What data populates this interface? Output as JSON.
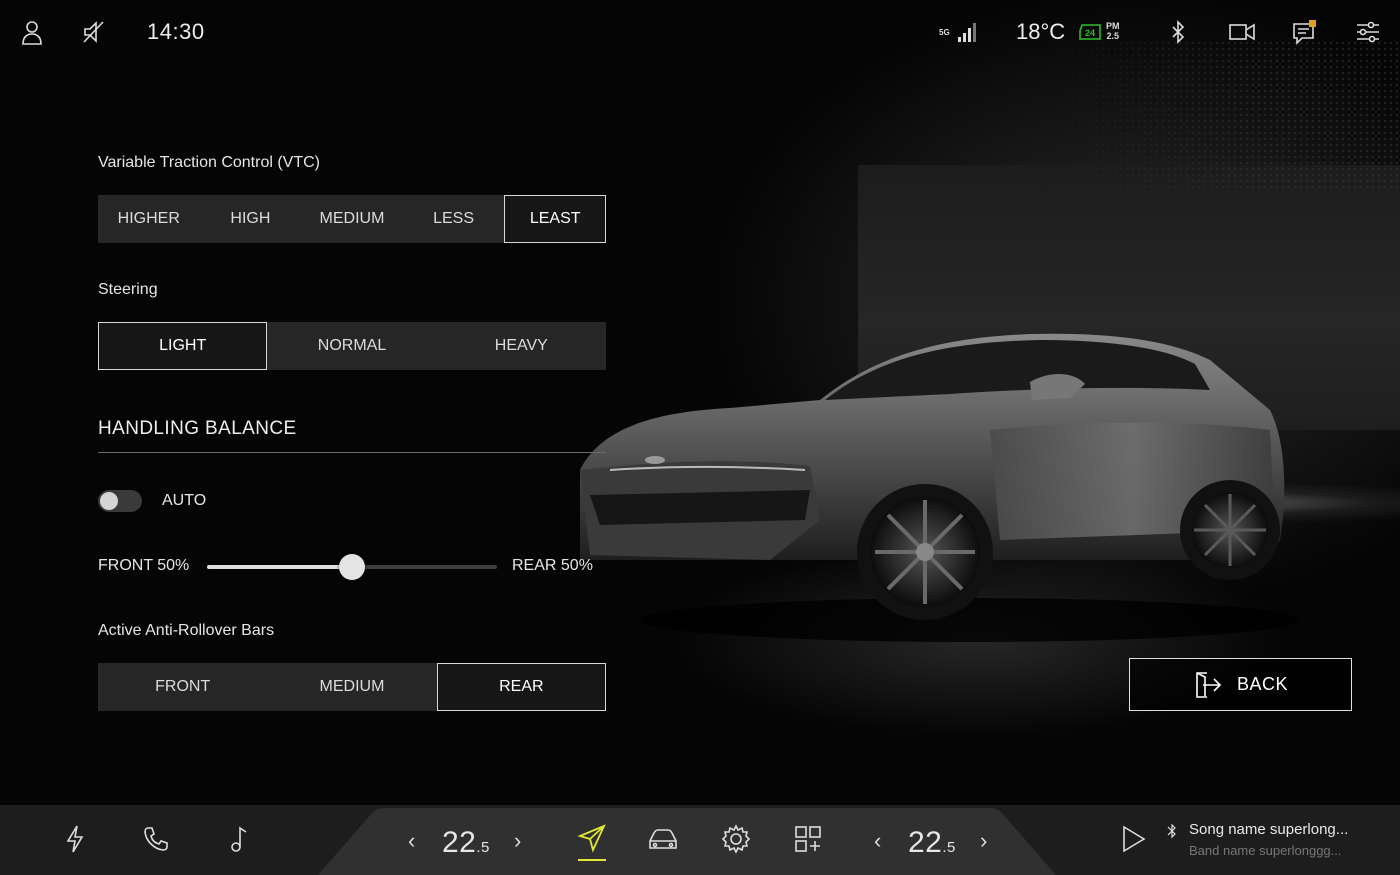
{
  "status_bar": {
    "time": "14:30",
    "network": "5G",
    "temperature": "18°C",
    "battery_charge": "24",
    "air_quality": {
      "label": "PM",
      "value": "2.5"
    },
    "icons": [
      "user-icon",
      "mute-icon",
      "signal-icon",
      "battery-icon",
      "bluetooth-icon",
      "camera-icon",
      "messages-icon",
      "settings-sliders-icon"
    ],
    "accent_green": "#2dbf2d",
    "badge_color": "#e0a020"
  },
  "vtc": {
    "label": "Variable Traction Control (VTC)",
    "options": [
      "HIGHER",
      "HIGH",
      "MEDIUM",
      "LESS",
      "LEAST"
    ],
    "selected": "LEAST"
  },
  "steering": {
    "label": "Steering",
    "options": [
      "LIGHT",
      "NORMAL",
      "HEAVY"
    ],
    "selected": "LIGHT"
  },
  "handling_balance": {
    "title": "HANDLING BALANCE",
    "auto_label": "AUTO",
    "auto_enabled": false,
    "front_label": "FRONT 50%",
    "rear_label": "REAR 50%",
    "balance_front_fraction": 0.5
  },
  "anti_rollover": {
    "label": "Active Anti-Rollover Bars",
    "options": [
      "FRONT",
      "MEDIUM",
      "REAR"
    ],
    "selected": "REAR"
  },
  "back_button": {
    "label": "BACK"
  },
  "dock": {
    "left_climate": {
      "value": "22",
      "decimal": ".5"
    },
    "right_climate": {
      "value": "22",
      "decimal": ".5"
    },
    "arrow_left": "‹",
    "arrow_right": "›",
    "active_accent": "#e2e833",
    "icons": [
      "charging-icon",
      "phone-icon",
      "music-icon",
      "navigation-icon",
      "car-icon",
      "settings-gear-icon",
      "apps-grid-icon",
      "play-icon"
    ],
    "media": {
      "song": "Song name superlong...",
      "band": "Band name superlonggg..."
    }
  }
}
